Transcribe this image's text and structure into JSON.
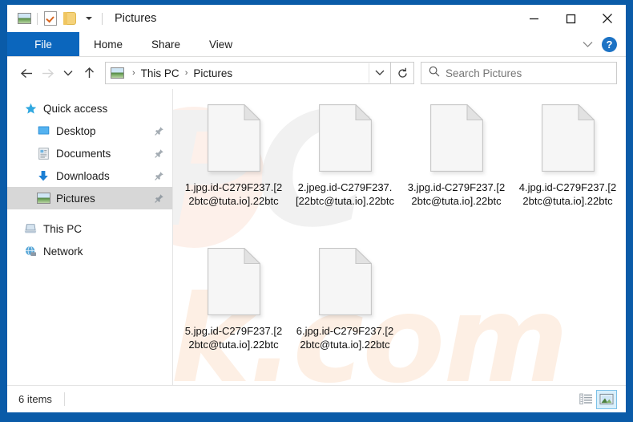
{
  "window": {
    "title": "Pictures",
    "quick_access_toolbar": [
      {
        "name": "pictures-icon",
        "label": "Pictures"
      },
      {
        "name": "properties-icon",
        "label": "Properties"
      },
      {
        "name": "new-folder-icon",
        "label": "New folder"
      },
      {
        "name": "customize-dropdown-icon",
        "label": "Customize Quick Access Toolbar"
      }
    ],
    "controls": {
      "minimize": "Minimize",
      "maximize": "Maximize",
      "close": "Close"
    },
    "frame_color": "#0a5ba8"
  },
  "ribbon": {
    "tabs": [
      {
        "label": "File",
        "active": true
      },
      {
        "label": "Home",
        "active": false
      },
      {
        "label": "Share",
        "active": false
      },
      {
        "label": "View",
        "active": false
      }
    ],
    "collapse_label": "Minimize the Ribbon",
    "help_label": "?",
    "accent_color": "#0b66bd"
  },
  "address_bar": {
    "back_label": "Back",
    "forward_label": "Forward",
    "recent_label": "Recent locations",
    "up_label": "Up",
    "breadcrumbs": [
      "This PC",
      "Pictures"
    ],
    "separator": "›",
    "dropdown_label": "Previous locations",
    "refresh_label": "Refresh"
  },
  "search": {
    "placeholder": "Search Pictures",
    "value": "",
    "icon": "search-icon"
  },
  "sidebar": {
    "items": [
      {
        "label": "Quick access",
        "icon": "star-icon",
        "level": 0,
        "pinned": false,
        "selected": false
      },
      {
        "label": "Desktop",
        "icon": "desktop-icon",
        "level": 1,
        "pinned": true,
        "selected": false
      },
      {
        "label": "Documents",
        "icon": "documents-icon",
        "level": 1,
        "pinned": true,
        "selected": false
      },
      {
        "label": "Downloads",
        "icon": "downloads-icon",
        "level": 1,
        "pinned": true,
        "selected": false
      },
      {
        "label": "Pictures",
        "icon": "pictures-icon",
        "level": 1,
        "pinned": true,
        "selected": true
      },
      {
        "label": "This PC",
        "icon": "this-pc-icon",
        "level": 0,
        "pinned": false,
        "selected": false
      },
      {
        "label": "Network",
        "icon": "network-icon",
        "level": 0,
        "pinned": false,
        "selected": false
      }
    ]
  },
  "files": [
    {
      "name": "1.jpg.id-C279F237.[22btc@tuta.io].22btc",
      "icon": "generic-file-icon"
    },
    {
      "name": "2.jpeg.id-C279F237.[22btc@tuta.io].22btc",
      "icon": "generic-file-icon"
    },
    {
      "name": "3.jpg.id-C279F237.[22btc@tuta.io].22btc",
      "icon": "generic-file-icon"
    },
    {
      "name": "4.jpg.id-C279F237.[22btc@tuta.io].22btc",
      "icon": "generic-file-icon"
    },
    {
      "name": "5.jpg.id-C279F237.[22btc@tuta.io].22btc",
      "icon": "generic-file-icon"
    },
    {
      "name": "6.jpg.id-C279F237.[22btc@tuta.io].22btc",
      "icon": "generic-file-icon"
    }
  ],
  "watermark": {
    "top_text": "PC",
    "bottom_text": "risk.com"
  },
  "status_bar": {
    "item_count": "6 items",
    "details_view_label": "Details view",
    "large_icons_view_label": "Large icons view",
    "active_view": "large-icons",
    "active_highlight_color": "#d9effb"
  }
}
